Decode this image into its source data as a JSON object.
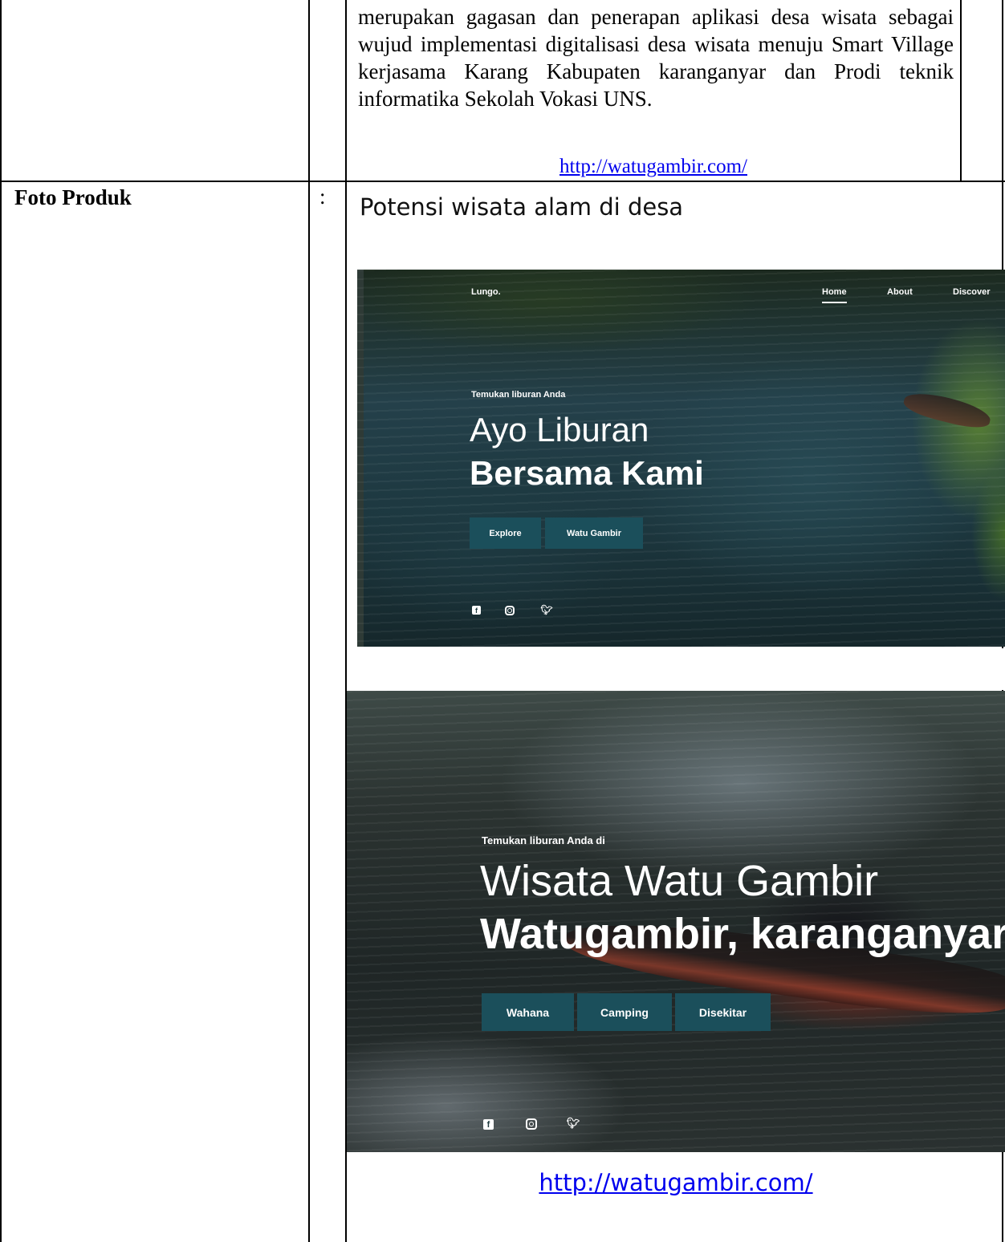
{
  "document": {
    "description": "merupakan gagasan dan penerapan aplikasi desa wisata sebagai wujud  implementasi digitalisasi desa wisata menuju Smart Village kerjasama Karang Kabupaten karanganyar dan Prodi teknik informatika Sekolah Vokasi UNS.",
    "link_top": "http://watugambir.com/",
    "label": "Foto Produk",
    "colon": ":",
    "caption": "Potensi wisata alam di desa",
    "link_bottom": "http://watugambir.com/"
  },
  "screenshot1": {
    "brand": "Lungo.",
    "nav": [
      "Home",
      "About",
      "Discover"
    ],
    "tagline": "Temukan liburan Anda",
    "hero_light": "Ayo Liburan",
    "hero_bold": "Bersama Kami",
    "buttons": [
      "Explore",
      "Watu Gambir"
    ],
    "social_icons": [
      "facebook-icon",
      "instagram-icon",
      "twitter-icon"
    ],
    "button_color": "#1b4f5b"
  },
  "screenshot2": {
    "tagline": "Temukan liburan Anda di",
    "hero_light": "Wisata Watu Gambir",
    "hero_bold": "Watugambir, karanganyar",
    "buttons": [
      "Wahana",
      "Camping",
      "Disekitar"
    ],
    "social_icons": [
      "facebook-icon",
      "instagram-icon",
      "twitter-icon"
    ],
    "button_color": "#1b4f5b"
  }
}
